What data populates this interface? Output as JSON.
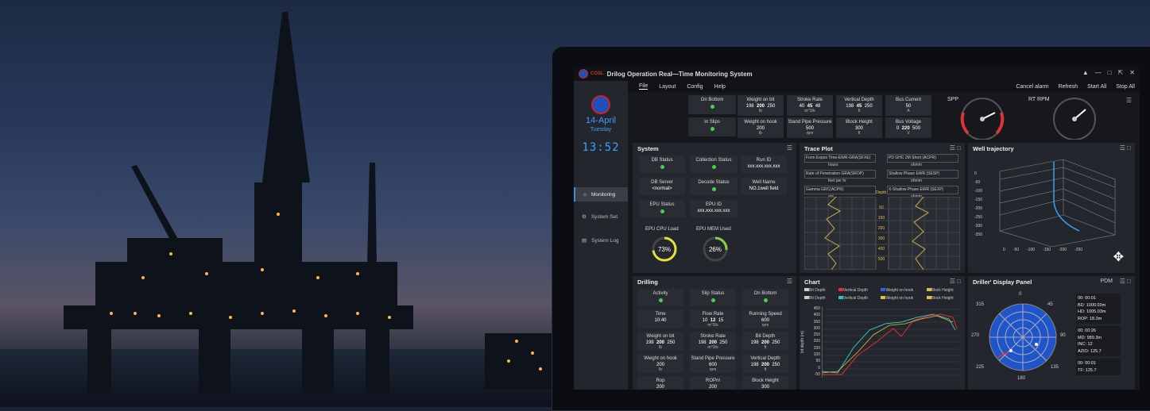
{
  "app": {
    "title": "Drilog Operation Real—Time Monitoring System",
    "logo_text": "COSL"
  },
  "sidebar": {
    "date": "14-April",
    "day": "Tuesday",
    "time": "13:52",
    "items": [
      {
        "label": "Monitoring"
      },
      {
        "label": "System Set"
      },
      {
        "label": "System Log"
      }
    ]
  },
  "menu": {
    "items": [
      "File",
      "Layout",
      "Config",
      "Help"
    ],
    "actions": [
      "Cancel alarm",
      "Refresh",
      "Start All",
      "Stop All"
    ]
  },
  "top": {
    "on_bottom": "On Bottom",
    "in_slips": "In Slips",
    "wob": {
      "label": "Weight on bit",
      "min": "198",
      "val": "200",
      "max": "250",
      "unit": "lb"
    },
    "woh": {
      "label": "Weight on hook",
      "val": "200",
      "unit": "lb"
    },
    "stroke": {
      "label": "Stroke Rate",
      "min": "40",
      "val": "45",
      "max": "48",
      "unit": "m^3/k"
    },
    "spp": {
      "label": "Stand Pipe Pressure",
      "val": "500",
      "unit": "rpm"
    },
    "vdepth": {
      "label": "Vertical Depth",
      "min": "198",
      "val": "45",
      "max": "250",
      "unit": "ft"
    },
    "bheight": {
      "label": "Block Height",
      "val": "300",
      "unit": "ft"
    },
    "bcurrent": {
      "label": "Bus Current",
      "val": "50",
      "unit": "A"
    },
    "bvoltage": {
      "label": "Bus Voltage",
      "min": "0",
      "val": "220",
      "max": "500",
      "unit": "V"
    },
    "gauge1": "SPP",
    "gauge2": "RT RPM"
  },
  "system": {
    "title": "System",
    "db_status": "DB Status",
    "collection_status": "Collection Status",
    "run_id": "Run ID",
    "run_id_val": "xxx.xxx.xxx.xxx",
    "db_server": "DB Server",
    "db_server_val": "<normal>",
    "decode_status": "Decode Status",
    "well_name": "Well Name",
    "well_name_val": "NO.1well field",
    "epu_status": "EPU Status",
    "epu_id": "EPU ID",
    "epu_id_val": "xxx.xxx.xxx.xxx",
    "cpu_label": "EPU CPU Load",
    "cpu": "73%",
    "cpu_pct": 73,
    "mem_label": "EPU MEM Used",
    "mem": "26%",
    "mem_pct": 26
  },
  "trace": {
    "title": "Trace Plot",
    "left_curves": [
      "Form Expos Time-EWR·GRA(SFXE)",
      "Rate of Penetration GRA(SROP)",
      "Gamma GRC(ACPR)"
    ],
    "left_units": [
      "hours",
      "feet per hr",
      "api"
    ],
    "right_curves": [
      "PD GHC 2M Short (ACPR)",
      "Shallow Phase EWR (SESP)",
      "X-Shallow Phase EWR (SEXP)"
    ],
    "right_units": [
      "ohmm",
      "ohmm",
      "ohmm"
    ],
    "depth_label": "Depth",
    "depths": [
      "50",
      "150",
      "200",
      "300",
      "400",
      "500"
    ]
  },
  "well": {
    "title": "Well trajectory",
    "z_ticks": [
      "0",
      "-50",
      "-100",
      "-150",
      "-200",
      "-250",
      "-300",
      "-350"
    ],
    "x_ticks": [
      "0",
      "-50",
      "-100",
      "-150",
      "-200",
      "-250"
    ]
  },
  "drilling": {
    "title": "Drilling",
    "activity": "Activity",
    "slip_status": "Slip Status",
    "on_bottom": "On Bottom",
    "time": "Time",
    "time_val": "10:40",
    "flow": "Flow Rate",
    "flow_min": "10",
    "flow_val": "12",
    "flow_max": "15",
    "flow_unit": "m^3/s",
    "speed": "Running Speed",
    "speed_val": "600",
    "speed_unit": "rpm",
    "wob": "Weight on bit",
    "wob_min": "198",
    "wob_val": "200",
    "wob_max": "250",
    "wob_unit": "lb",
    "stroke": "Stroke Rate",
    "stroke_min": "198",
    "stroke_val": "200",
    "stroke_max": "250",
    "stroke_unit": "m^3/s",
    "bitdepth": "Bit Depth",
    "bd_min": "198",
    "bd_val": "200",
    "bd_max": "250",
    "bd_unit": "ft",
    "woh": "Weight on hook",
    "woh_val": "200",
    "woh_unit": "lb",
    "spp": "Stand Pipe Pressure",
    "spp_val": "600",
    "spp_unit": "rpm",
    "vd": "Vertical Depth",
    "vd_min": "198",
    "vd_val": "200",
    "vd_max": "250",
    "vd_unit": "ft",
    "rop": "Rop",
    "rop_val": "200",
    "ropm": "ROPm",
    "ropm_val": "200",
    "bh": "Block Height",
    "bh_val": "300"
  },
  "chart": {
    "title": "Chart",
    "legend": [
      "Bit Depth",
      "Vertical Depth",
      "Weight on hook",
      "Block Height",
      "Bit Depth",
      "Vertical Depth",
      "Weight on hook",
      "Block Height"
    ],
    "ylabel": "bit depth (m)",
    "yticks": [
      "450",
      "400",
      "350",
      "300",
      "250",
      "200",
      "150",
      "100",
      "50",
      "0",
      "-50"
    ]
  },
  "driller": {
    "title": "Driller' Display Panel",
    "mode": "PDM",
    "angles": [
      "0",
      "45",
      "90",
      "135",
      "180",
      "225",
      "270",
      "315"
    ],
    "info": [
      "00: 00:01",
      "BD: 1000.03m",
      "HD: 1005.03m",
      "ROP: 18.3m",
      "00: 00:26",
      "MD: 989.3m",
      "INC: 12",
      "AZIO: 125.7",
      "00: 00:01",
      "TF: 125.7"
    ]
  }
}
